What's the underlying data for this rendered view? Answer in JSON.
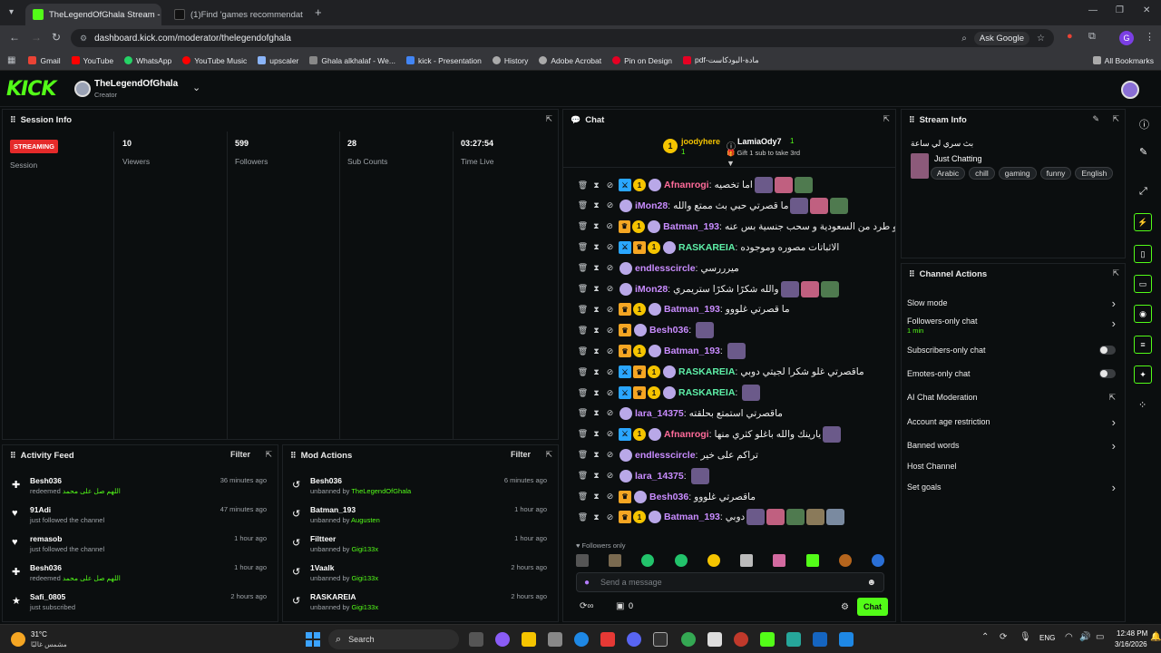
{
  "browser": {
    "tabs": [
      {
        "label": "TheLegendOfGhala Stream - Ki",
        "color": "#53fc18"
      },
      {
        "label": "(1)Find 'games recommendati",
        "color": "#111111"
      }
    ],
    "url": "dashboard.kick.com/moderator/thelegendofghala",
    "ask_google": "Ask Google",
    "profile_letter": "G",
    "bookmarks": [
      {
        "label": "Gmail",
        "color": "#ea4335"
      },
      {
        "label": "YouTube",
        "color": "#ff0000"
      },
      {
        "label": "WhatsApp",
        "color": "#25d366"
      },
      {
        "label": "YouTube Music",
        "color": "#ff0000"
      },
      {
        "label": "upscaler",
        "color": "#8ab4f8"
      },
      {
        "label": "Ghala alkhalaf - We...",
        "color": "#888888"
      },
      {
        "label": "kick - Presentation",
        "color": "#4285f4"
      },
      {
        "label": "History",
        "color": "#aaaaaa"
      },
      {
        "label": "Adobe Acrobat",
        "color": "#aaaaaa"
      },
      {
        "label": "Pin on Design",
        "color": "#e60023"
      },
      {
        "label": "pdf-مادة-البودكاست",
        "color": "#e60023"
      }
    ],
    "all_bookmarks": "All Bookmarks"
  },
  "kick": {
    "logo": "KICK",
    "channel_name": "TheLegendOfGhala",
    "channel_role": "Creator"
  },
  "session": {
    "title": "Session Info",
    "status_badge": "STREAMING",
    "session_label": "Session",
    "stats": [
      {
        "value": "10",
        "label": "Viewers"
      },
      {
        "value": "599",
        "label": "Followers"
      },
      {
        "value": "28",
        "label": "Sub Counts"
      },
      {
        "value": "03:27:54",
        "label": "Time Live"
      }
    ]
  },
  "activity": {
    "title": "Activity Feed",
    "filter": "Filter",
    "items": [
      {
        "icon": "✚",
        "name": "Besh036",
        "sub": "redeemed",
        "extra": "اللهم صل على محمد",
        "time": "36 minutes ago"
      },
      {
        "icon": "♥",
        "name": "91Adi",
        "sub": "just followed the channel",
        "extra": "",
        "time": "47 minutes ago"
      },
      {
        "icon": "♥",
        "name": "remasob",
        "sub": "just followed the channel",
        "extra": "",
        "time": "1 hour ago"
      },
      {
        "icon": "✚",
        "name": "Besh036",
        "sub": "redeemed",
        "extra": "اللهم صل على محمد",
        "time": "1 hour ago"
      },
      {
        "icon": "★",
        "name": "Safi_0805",
        "sub": "just subscribed",
        "extra": "",
        "time": "2 hours ago"
      }
    ]
  },
  "mod_actions": {
    "title": "Mod Actions",
    "filter": "Filter",
    "items": [
      {
        "name": "Besh036",
        "sub": "unbanned by",
        "by": "TheLegendOfGhala",
        "time": "6 minutes ago"
      },
      {
        "name": "Batman_193",
        "sub": "unbanned by",
        "by": "Augusten",
        "time": "1 hour ago"
      },
      {
        "name": "Filtteer",
        "sub": "unbanned by",
        "by": "Gigi133x",
        "time": "1 hour ago"
      },
      {
        "name": "1Vaalk",
        "sub": "unbanned by",
        "by": "Gigi133x",
        "time": "2 hours ago"
      },
      {
        "name": "RASKAREIA",
        "sub": "unbanned by",
        "by": "Gigi133x",
        "time": "2 hours ago"
      }
    ]
  },
  "chat": {
    "title": "Chat",
    "gift_bar": {
      "user1": "joodyhere",
      "user1_count": "1",
      "user2": "LamiaOdy7",
      "user2_count": "1",
      "gift_text": "Gift 1 sub to take 3rd"
    },
    "messages": [
      {
        "user": "Afnanrogi",
        "color": "#ff6b9a",
        "mod": true,
        "vip": false,
        "sub": true,
        "text": "اما تخصيه",
        "emotes": 3
      },
      {
        "user": "iMon28",
        "color": "#c98cff",
        "mod": false,
        "vip": false,
        "sub": false,
        "text": "ما قصرتي حبي بث ممتع والله",
        "emotes": 3
      },
      {
        "user": "Batman_193",
        "color": "#c98cff",
        "mod": false,
        "vip": true,
        "sub": true,
        "text": "بيشو طرد من السعودية و سحب جنسية بس عنه",
        "emotes": 0
      },
      {
        "user": "RASKAREIA",
        "color": "#5ef0a8",
        "mod": true,
        "vip": true,
        "sub": true,
        "text": "الاثباتات مصوره وموجوده",
        "emotes": 0
      },
      {
        "user": "endlesscircle",
        "color": "#c98cff",
        "mod": false,
        "vip": false,
        "sub": false,
        "text": "ميرررسي",
        "emotes": 0
      },
      {
        "user": "iMon28",
        "color": "#c98cff",
        "mod": false,
        "vip": false,
        "sub": false,
        "text": "والله شكرًا شكرًا ستريمري",
        "emotes": 3
      },
      {
        "user": "Batman_193",
        "color": "#c98cff",
        "mod": false,
        "vip": true,
        "sub": true,
        "text": "ما قصرتي غلووو",
        "emotes": 0
      },
      {
        "user": "Besh036",
        "color": "#c98cff",
        "mod": false,
        "vip": true,
        "sub": false,
        "text": "",
        "emotes": 1
      },
      {
        "user": "Batman_193",
        "color": "#c98cff",
        "mod": false,
        "vip": true,
        "sub": true,
        "text": "",
        "emotes": 1
      },
      {
        "user": "RASKAREIA",
        "color": "#5ef0a8",
        "mod": true,
        "vip": true,
        "sub": true,
        "text": "ماقصرتي غلو شكرا لجيتي دوبي",
        "emotes": 0
      },
      {
        "user": "RASKAREIA",
        "color": "#5ef0a8",
        "mod": true,
        "vip": true,
        "sub": true,
        "text": "",
        "emotes": 1
      },
      {
        "user": "lara_14375",
        "color": "#c98cff",
        "mod": false,
        "vip": false,
        "sub": false,
        "text": "ماقصرتي استمتع بحلقته",
        "emotes": 0
      },
      {
        "user": "Afnanrogi",
        "color": "#ff6b9a",
        "mod": true,
        "vip": false,
        "sub": true,
        "text": "يارينك والله باغلو كثري منها",
        "emotes": 1
      },
      {
        "user": "endlesscircle",
        "color": "#c98cff",
        "mod": false,
        "vip": false,
        "sub": false,
        "text": "تراكم على خير",
        "emotes": 0
      },
      {
        "user": "lara_14375",
        "color": "#c98cff",
        "mod": false,
        "vip": false,
        "sub": false,
        "text": "",
        "emotes": 1
      },
      {
        "user": "Besh036",
        "color": "#c98cff",
        "mod": false,
        "vip": true,
        "sub": false,
        "text": "ماقصرتي غلووو",
        "emotes": 0
      },
      {
        "user": "Batman_193",
        "color": "#c98cff",
        "mod": false,
        "vip": true,
        "sub": true,
        "text": "دوبي",
        "emotes": 5
      }
    ],
    "followers_only": "Followers only",
    "placeholder": "Send a message",
    "count": "0",
    "chat_button": "Chat"
  },
  "stream_info": {
    "title": "Stream Info",
    "stream_title": "بث سري لي ساعة",
    "category": "Just Chatting",
    "tags": [
      "Arabic",
      "chill",
      "gaming",
      "funny",
      "English"
    ]
  },
  "channel_actions": {
    "title": "Channel Actions",
    "rows": [
      {
        "label": "Slow mode",
        "sub": "",
        "control": "arrow"
      },
      {
        "label": "Followers-only chat",
        "sub": "1 min",
        "control": "arrow"
      },
      {
        "label": "Subscribers-only chat",
        "sub": "",
        "control": "toggle"
      },
      {
        "label": "Emotes-only chat",
        "sub": "",
        "control": "toggle"
      },
      {
        "label": "AI Chat Moderation",
        "sub": "",
        "control": "external"
      },
      {
        "label": "Account age restriction",
        "sub": "",
        "control": "arrow"
      },
      {
        "label": "Banned words",
        "sub": "",
        "control": "arrow"
      },
      {
        "label": "Host Channel",
        "sub": "",
        "control": "none"
      },
      {
        "label": "Set goals",
        "sub": "",
        "control": "arrow"
      }
    ]
  },
  "taskbar": {
    "weather_temp": "31°C",
    "weather_desc": "مشمس غالبًا",
    "search": "Search",
    "lang": "ENG",
    "time": "12:48 PM",
    "date": "3/16/2026"
  }
}
